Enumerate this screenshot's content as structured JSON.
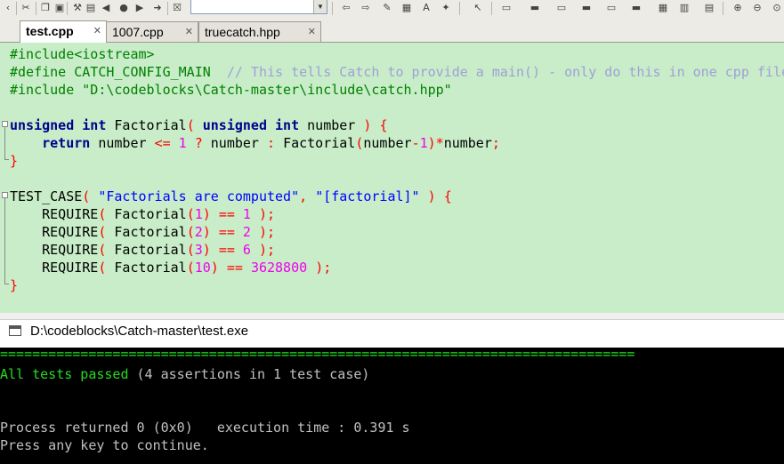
{
  "toolbar": {
    "icons": [
      "back-icon",
      "forward-icon",
      "stop-icon",
      "bookmark-icon",
      "search-icon",
      "run-icon",
      "debug-icon",
      "highlight-icon",
      "block-icon",
      "text-icon",
      "cursor-icon",
      "pointer-icon",
      "window-icon",
      "window2-icon",
      "window3-icon",
      "grid-icon",
      "zoom-in-icon",
      "zoom-out-icon",
      "zoom-fit-icon"
    ],
    "combo_value": ""
  },
  "tabs": [
    {
      "label": "test.cpp",
      "active": true
    },
    {
      "label": "1007.cpp",
      "active": false
    },
    {
      "label": "truecatch.hpp",
      "active": false
    }
  ],
  "editor": {
    "background": "#c8edc8",
    "lines": {
      "l1": "#include<iostream>",
      "l2a": "#define CATCH_CONFIG_MAIN  ",
      "l2b": "// This tells Catch to provide a main() - only do this in one cpp file",
      "l3": "#include \"D:\\codeblocks\\Catch-master\\include\\catch.hpp\"",
      "kw_unsigned": "unsigned",
      "kw_int": "int",
      "kw_return": "return",
      "factorial": "Factorial",
      "number": "number",
      "test_case": "TEST_CASE",
      "tc_name": "\"Factorials are computed\"",
      "tc_tag": "\"[factorial]\"",
      "require": "REQUIRE",
      "n1": "1",
      "n2": "2",
      "n3": "3",
      "n6": "6",
      "n10": "10",
      "n3628800": "3628800"
    }
  },
  "console": {
    "title": "D:\\codeblocks\\Catch-master\\test.exe",
    "separator": "===============================================================================",
    "passed_a": "All tests passed",
    "passed_b": " (4 assertions in 1 test case)",
    "process": "Process returned 0 (0x0)   execution time : 0.391 s",
    "press": "Press any key to continue."
  }
}
